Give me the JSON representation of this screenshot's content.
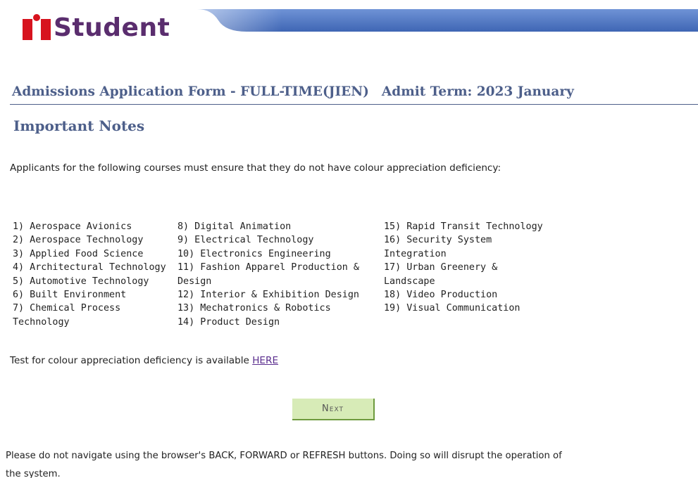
{
  "header": {
    "logo_text": "Student",
    "logo_icon": "student-person-icon",
    "brand_color": "#5a2d6e",
    "banner_color": "#4f79c4"
  },
  "form": {
    "title": "Admissions Application Form - FULL-TIME(JIEN)",
    "admit_term": "Admit Term: 2023 January",
    "title_color": "#4d5f8a"
  },
  "notes": {
    "heading": "Important Notes",
    "intro": "Applicants for the following courses must ensure that they do not have colour appreciation deficiency:",
    "courses_col1": [
      "1) Aerospace Avionics",
      "2) Aerospace Technology",
      "3) Applied Food Science",
      "4) Architectural Technology",
      "5) Automotive Technology",
      "6) Built Environment",
      "7) Chemical Process Technology"
    ],
    "courses_col2": [
      "8) Digital Animation",
      "9) Electrical Technology",
      "10) Electronics Engineering",
      "11) Fashion Apparel Production & Design",
      "12) Interior & Exhibition Design",
      "13) Mechatronics & Robotics",
      "14) Product Design"
    ],
    "courses_col3": [
      "15) Rapid Transit Technology",
      "16) Security System Integration",
      "17) Urban Greenery & Landscape",
      "18) Video Production",
      "19) Visual Communication"
    ],
    "test_text": "Test for colour appreciation deficiency is available ",
    "test_link": "HERE"
  },
  "actions": {
    "next_label": "Next",
    "button_color": "#d7ebb7"
  },
  "footer": {
    "warning": "Please do not navigate using the browser's BACK, FORWARD or REFRESH buttons. Doing so will disrupt the operation of the system."
  }
}
